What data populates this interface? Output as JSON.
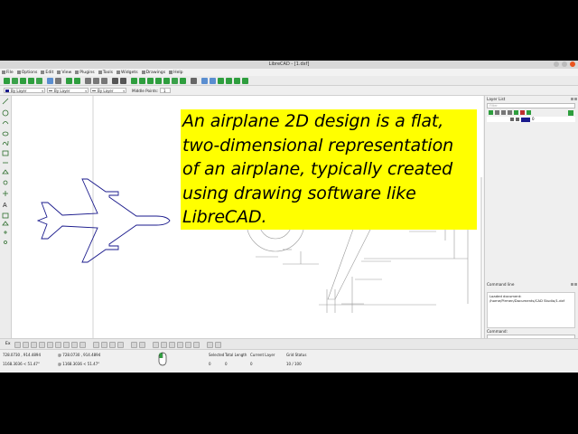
{
  "window": {
    "title": "LibreCAD - [1.dxf]"
  },
  "menu": [
    "File",
    "Options",
    "Edit",
    "View",
    "Plugins",
    "Tools",
    "Widgets",
    "Drawings",
    "Help"
  ],
  "pen_toolbar": {
    "color_label": "By Layer",
    "linetype_label": "By Layer",
    "width_label": "By Layer",
    "middle_points_label": "Middle Points:",
    "middle_points_value": "1"
  },
  "layer_list": {
    "title": "Layer List",
    "filter_placeholder": "Filter",
    "layer_name": "0"
  },
  "command_line": {
    "title": "Command line",
    "log": "Loaded document: /home/Pirmen/Documents/CAD Studio/1.dxf",
    "input_label": "Command:"
  },
  "snap_toolbar": {
    "ex_label": "Ex"
  },
  "status": {
    "coord_abs_1": "728.0730 , 914.4894",
    "coord_abs_2": "1168.3036 < 51.47°",
    "coord_rel_1": "@  728.0730 , 914.4894",
    "coord_rel_2": "@  1168.3036 < 51.47°",
    "selected_label": "Selected",
    "selected_value": "0",
    "total_length_label": "Total Length",
    "total_length_value": "0",
    "current_layer_label": "Current Layer",
    "current_layer_value": "0",
    "grid_status_label": "Grid Status",
    "grid_status_value": "10 / 100"
  },
  "caption": {
    "text": "An airplane 2D design is a flat, two-dimensional representation of an airplane, typically created using drawing software like LibreCAD."
  },
  "colors": {
    "accent_blue": "#1a1a8c",
    "highlight": "#ffff00",
    "toolbar_green": "#2e9e3e"
  }
}
